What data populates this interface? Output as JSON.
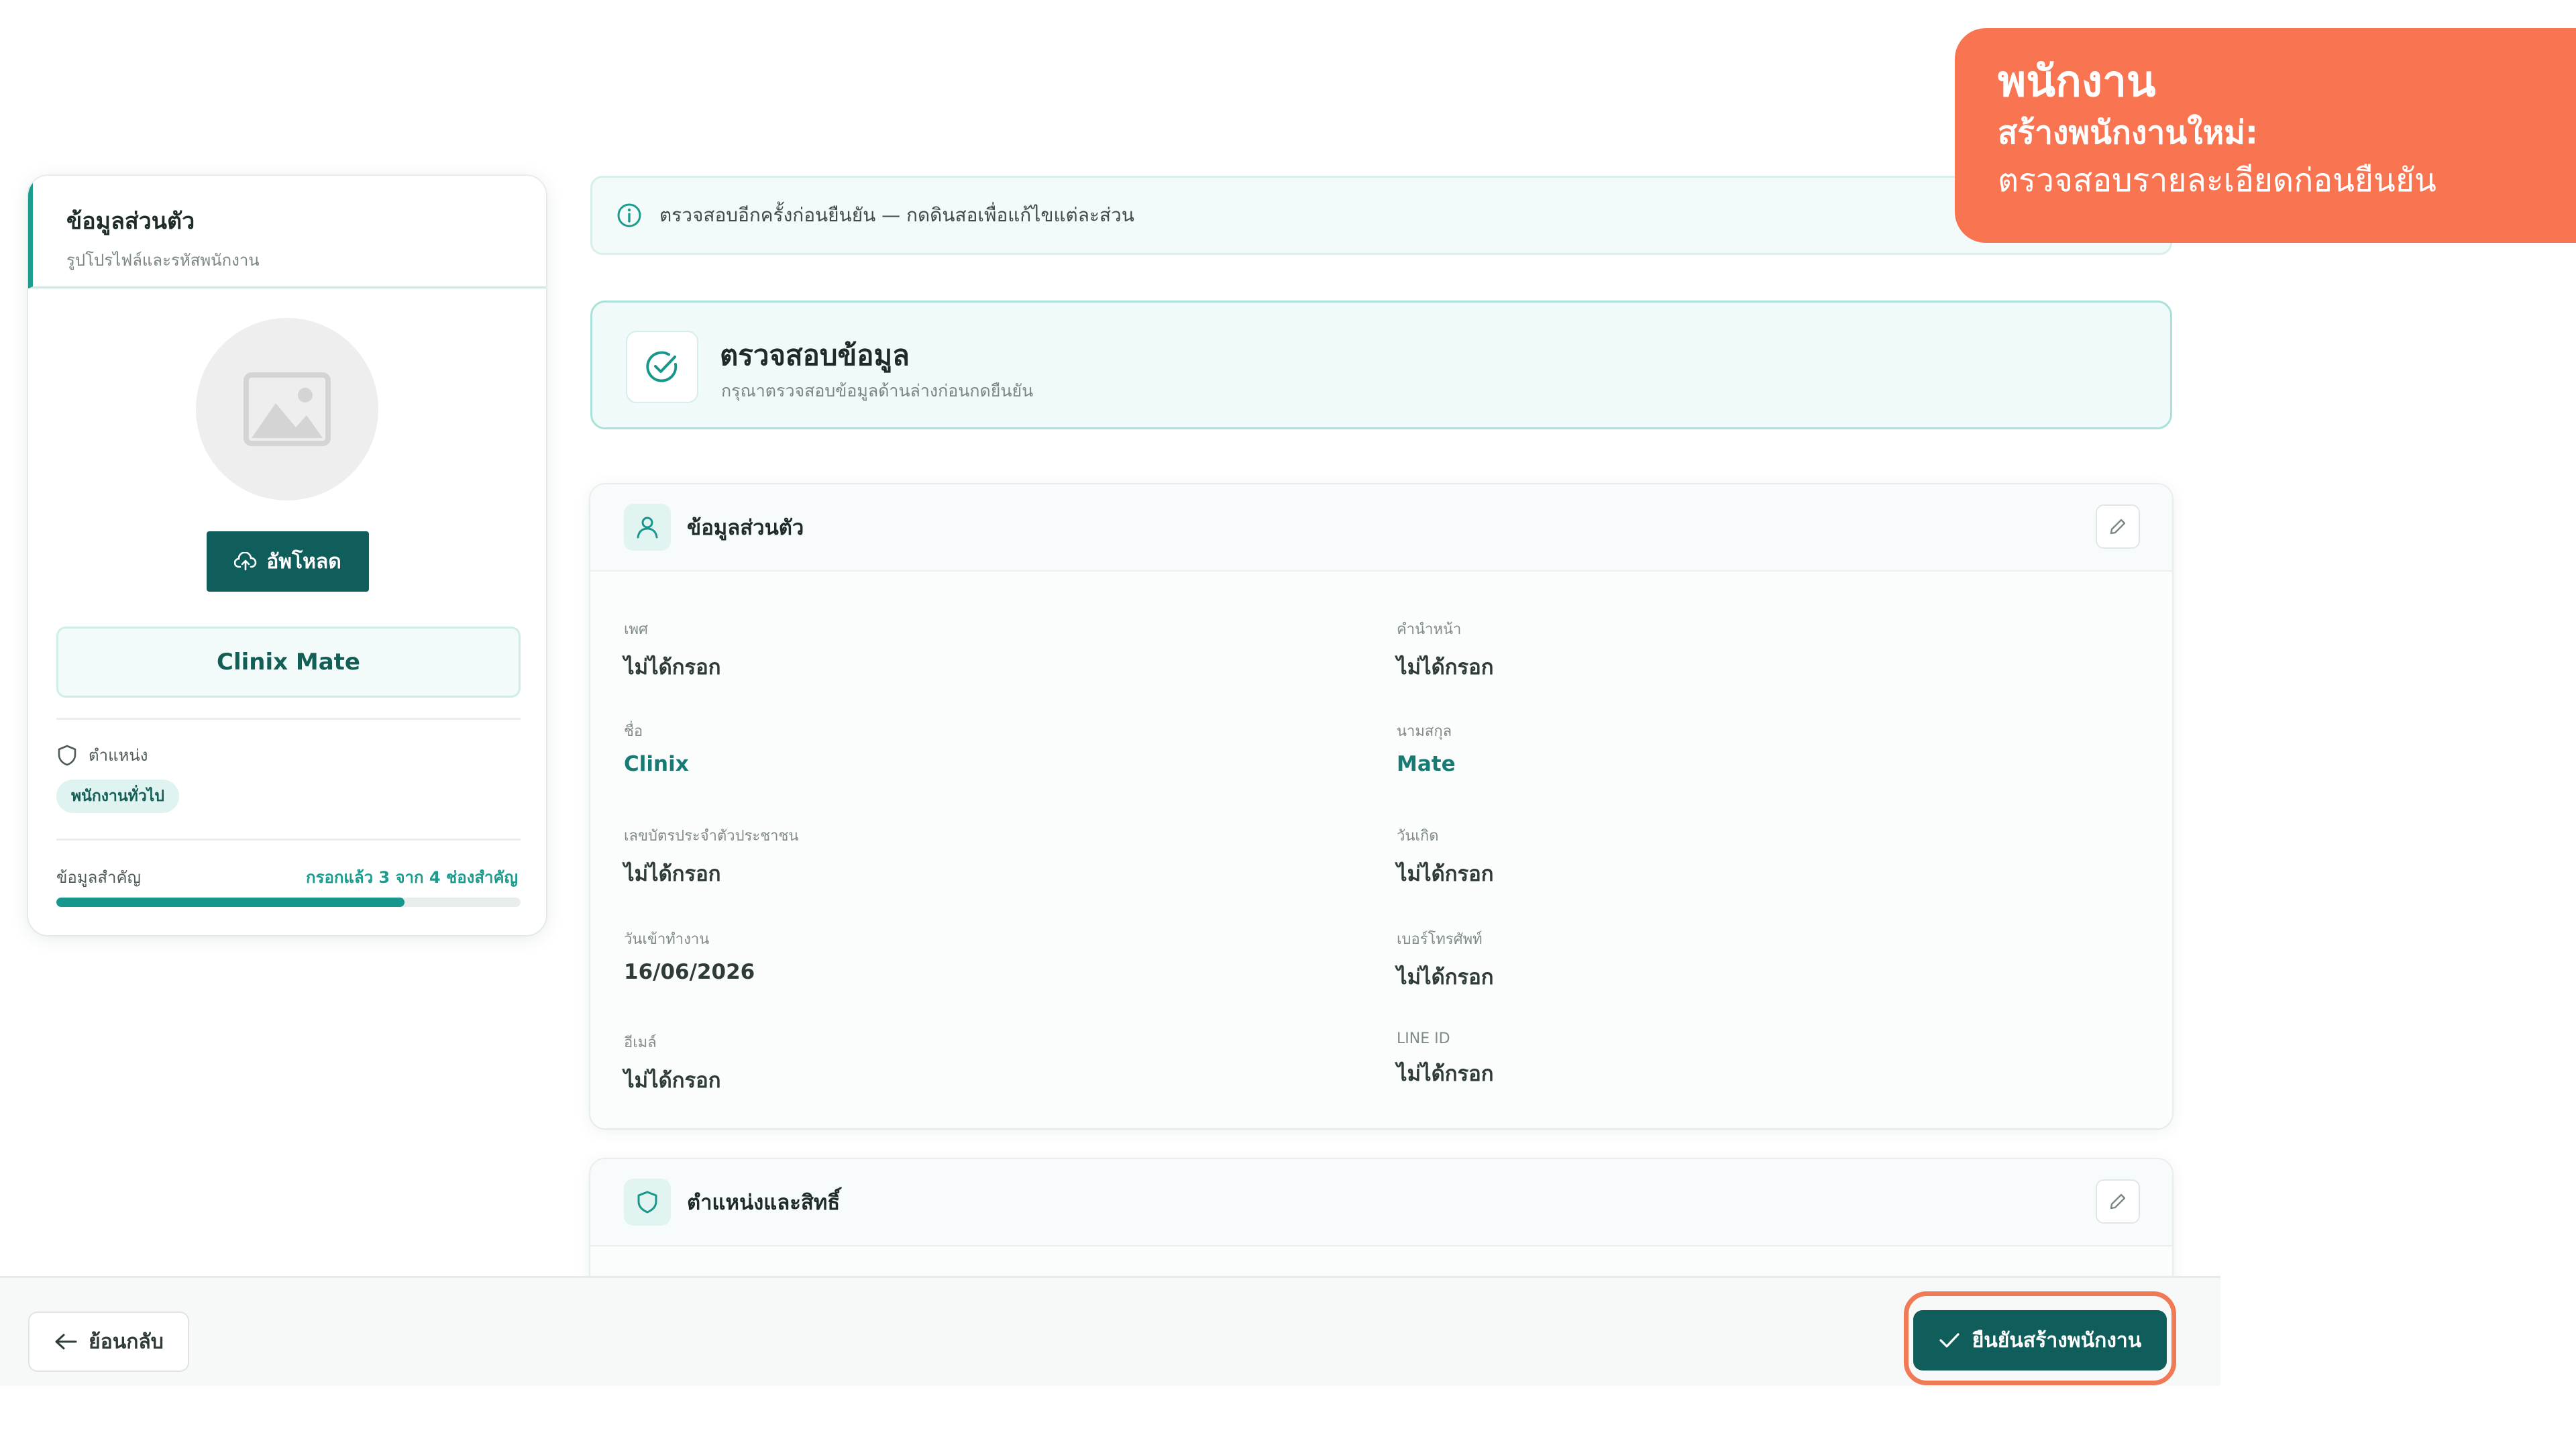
{
  "overlay": {
    "title": "พนักงาน",
    "subtitle": "สร้างพนักงานใหม่:",
    "description": "ตรวจสอบรายละเอียดก่อนยืนยัน"
  },
  "profile": {
    "title": "ข้อมูลส่วนตัว",
    "subtitle": "รูปโปรไฟล์และรหัสพนักงาน",
    "upload_label": "อัพโหลด",
    "display_name": "Clinix Mate",
    "role_label": "ตำแหน่ง",
    "role_value": "พนักงานทั่วไป",
    "progress_label": "ข้อมูลสำคัญ",
    "progress_status": "กรอกแล้ว 3 จาก 4 ช่องสำคัญ",
    "progress_fraction": 0.75
  },
  "banner": {
    "text": "ตรวจสอบอีกครั้งก่อนยืนยัน — กดดินสอเพื่อแก้ไขแต่ละส่วน"
  },
  "review": {
    "title": "ตรวจสอบข้อมูล",
    "subtitle": "กรุณาตรวจสอบข้อมูลด้านล่างก่อนกดยืนยัน"
  },
  "personal": {
    "title": "ข้อมูลส่วนตัว",
    "fields": [
      {
        "label": "เพศ",
        "value": "ไม่ได้กรอก"
      },
      {
        "label": "คำนำหน้า",
        "value": "ไม่ได้กรอก"
      },
      {
        "label": "ชื่อ",
        "value": "Clinix"
      },
      {
        "label": "นามสกุล",
        "value": "Mate"
      },
      {
        "label": "เลขบัตรประจำตัวประชาชน",
        "value": "ไม่ได้กรอก"
      },
      {
        "label": "วันเกิด",
        "value": "ไม่ได้กรอก"
      },
      {
        "label": "วันเข้าทำงาน",
        "value": "16/06/2026"
      },
      {
        "label": "เบอร์โทรศัพท์",
        "value": "ไม่ได้กรอก"
      },
      {
        "label": "อีเมล์",
        "value": "ไม่ได้กรอก"
      },
      {
        "label": "LINE ID",
        "value": "ไม่ได้กรอก"
      }
    ]
  },
  "permissions": {
    "title": "ตำแหน่งและสิทธิ์"
  },
  "footer": {
    "back_label": "ย้อนกลับ",
    "confirm_label": "ยืนยันสร้างพนักงาน"
  },
  "colors": {
    "accent": "#0f5e5b",
    "accent_light": "#17978b",
    "overlay": "#f97552"
  }
}
